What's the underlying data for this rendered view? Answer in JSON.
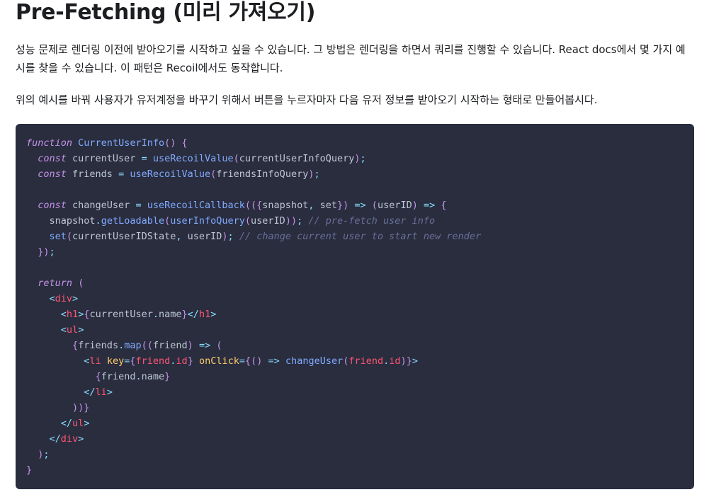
{
  "heading": "Pre-Fetching (미리 가져오기)",
  "paragraphs": [
    "성능 문제로 렌더링 이전에 받아오기를 시작하고 싶을 수 있습니다. 그 방법은 렌더링을 하면서 쿼리를 진행할 수 있습니다. React docs에서 몇 가지 예시를 찾을 수 있습니다. 이 패턴은 Recoil에서도 동작합니다.",
    "위의 예시를 바꿔 사용자가 유저계정을 바꾸기 위해서 버튼을 누르자마자 다음 유저 정보를 받아오기 시작하는 형태로 만들어봅시다."
  ],
  "code": {
    "language": "jsx",
    "lines": [
      [
        [
          "kw",
          "function"
        ],
        [
          "id",
          " "
        ],
        [
          "fn",
          "CurrentUserInfo"
        ],
        [
          "pu",
          "()"
        ],
        [
          "id",
          " "
        ],
        [
          "pu",
          "{"
        ]
      ],
      [
        [
          "id",
          "  "
        ],
        [
          "kw",
          "const"
        ],
        [
          "id",
          " currentUser "
        ],
        [
          "op",
          "="
        ],
        [
          "id",
          " "
        ],
        [
          "fn",
          "useRecoilValue"
        ],
        [
          "pu",
          "("
        ],
        [
          "id",
          "currentUserInfoQuery"
        ],
        [
          "pu",
          ")"
        ],
        [
          "op",
          ";"
        ]
      ],
      [
        [
          "id",
          "  "
        ],
        [
          "kw",
          "const"
        ],
        [
          "id",
          " friends "
        ],
        [
          "op",
          "="
        ],
        [
          "id",
          " "
        ],
        [
          "fn",
          "useRecoilValue"
        ],
        [
          "pu",
          "("
        ],
        [
          "id",
          "friendsInfoQuery"
        ],
        [
          "pu",
          ")"
        ],
        [
          "op",
          ";"
        ]
      ],
      [],
      [
        [
          "id",
          "  "
        ],
        [
          "kw",
          "const"
        ],
        [
          "id",
          " changeUser "
        ],
        [
          "op",
          "="
        ],
        [
          "id",
          " "
        ],
        [
          "fn",
          "useRecoilCallback"
        ],
        [
          "pu",
          "(({"
        ],
        [
          "id",
          "snapshot"
        ],
        [
          "op",
          ","
        ],
        [
          "id",
          " set"
        ],
        [
          "pu",
          "})"
        ],
        [
          "id",
          " "
        ],
        [
          "op",
          "=>"
        ],
        [
          "id",
          " "
        ],
        [
          "pu",
          "("
        ],
        [
          "id",
          "userID"
        ],
        [
          "pu",
          ")"
        ],
        [
          "id",
          " "
        ],
        [
          "op",
          "=>"
        ],
        [
          "id",
          " "
        ],
        [
          "pu",
          "{"
        ]
      ],
      [
        [
          "id",
          "    snapshot"
        ],
        [
          "op",
          "."
        ],
        [
          "fn",
          "getLoadable"
        ],
        [
          "pu",
          "("
        ],
        [
          "fn",
          "userInfoQuery"
        ],
        [
          "pu",
          "("
        ],
        [
          "id",
          "userID"
        ],
        [
          "pu",
          "))"
        ],
        [
          "op",
          ";"
        ],
        [
          "id",
          " "
        ],
        [
          "cm",
          "// pre-fetch user info"
        ]
      ],
      [
        [
          "id",
          "    "
        ],
        [
          "fn",
          "set"
        ],
        [
          "pu",
          "("
        ],
        [
          "id",
          "currentUserIDState"
        ],
        [
          "op",
          ","
        ],
        [
          "id",
          " userID"
        ],
        [
          "pu",
          ")"
        ],
        [
          "op",
          ";"
        ],
        [
          "id",
          " "
        ],
        [
          "cm",
          "// change current user to start new render"
        ]
      ],
      [
        [
          "id",
          "  "
        ],
        [
          "pu",
          "})"
        ],
        [
          "op",
          ";"
        ]
      ],
      [],
      [
        [
          "id",
          "  "
        ],
        [
          "kw",
          "return"
        ],
        [
          "id",
          " "
        ],
        [
          "pu",
          "("
        ]
      ],
      [
        [
          "id",
          "    "
        ],
        [
          "op",
          "<"
        ],
        [
          "tg",
          "div"
        ],
        [
          "op",
          ">"
        ]
      ],
      [
        [
          "id",
          "      "
        ],
        [
          "op",
          "<"
        ],
        [
          "tg",
          "h1"
        ],
        [
          "op",
          ">"
        ],
        [
          "pu",
          "{"
        ],
        [
          "id",
          "currentUser"
        ],
        [
          "op",
          "."
        ],
        [
          "id",
          "name"
        ],
        [
          "pu",
          "}"
        ],
        [
          "op",
          "</"
        ],
        [
          "tg",
          "h1"
        ],
        [
          "op",
          ">"
        ]
      ],
      [
        [
          "id",
          "      "
        ],
        [
          "op",
          "<"
        ],
        [
          "tg",
          "ul"
        ],
        [
          "op",
          ">"
        ]
      ],
      [
        [
          "id",
          "        "
        ],
        [
          "pu",
          "{"
        ],
        [
          "id",
          "friends"
        ],
        [
          "op",
          "."
        ],
        [
          "fn",
          "map"
        ],
        [
          "pu",
          "(("
        ],
        [
          "id",
          "friend"
        ],
        [
          "pu",
          ")"
        ],
        [
          "id",
          " "
        ],
        [
          "op",
          "=>"
        ],
        [
          "id",
          " "
        ],
        [
          "pu",
          "("
        ]
      ],
      [
        [
          "id",
          "          "
        ],
        [
          "op",
          "<"
        ],
        [
          "tg",
          "li"
        ],
        [
          "id",
          " "
        ],
        [
          "at",
          "key"
        ],
        [
          "op",
          "="
        ],
        [
          "pu",
          "{"
        ],
        [
          "tg",
          "friend"
        ],
        [
          "op",
          "."
        ],
        [
          "tg",
          "id"
        ],
        [
          "pu",
          "}"
        ],
        [
          "id",
          " "
        ],
        [
          "at",
          "onClick"
        ],
        [
          "op",
          "="
        ],
        [
          "pu",
          "{()"
        ],
        [
          "id",
          " "
        ],
        [
          "op",
          "=>"
        ],
        [
          "id",
          " "
        ],
        [
          "fn",
          "changeUser"
        ],
        [
          "pu",
          "("
        ],
        [
          "tg",
          "friend"
        ],
        [
          "op",
          "."
        ],
        [
          "tg",
          "id"
        ],
        [
          "pu",
          ")}"
        ],
        [
          "op",
          ">"
        ]
      ],
      [
        [
          "id",
          "            "
        ],
        [
          "pu",
          "{"
        ],
        [
          "id",
          "friend"
        ],
        [
          "op",
          "."
        ],
        [
          "id",
          "name"
        ],
        [
          "pu",
          "}"
        ]
      ],
      [
        [
          "id",
          "          "
        ],
        [
          "op",
          "</"
        ],
        [
          "tg",
          "li"
        ],
        [
          "op",
          ">"
        ]
      ],
      [
        [
          "id",
          "        "
        ],
        [
          "pu",
          "))}"
        ]
      ],
      [
        [
          "id",
          "      "
        ],
        [
          "op",
          "</"
        ],
        [
          "tg",
          "ul"
        ],
        [
          "op",
          ">"
        ]
      ],
      [
        [
          "id",
          "    "
        ],
        [
          "op",
          "</"
        ],
        [
          "tg",
          "div"
        ],
        [
          "op",
          ">"
        ]
      ],
      [
        [
          "id",
          "  "
        ],
        [
          "pu",
          ")"
        ],
        [
          "op",
          ";"
        ]
      ],
      [
        [
          "pu",
          "}"
        ]
      ]
    ]
  },
  "colors": {
    "code_background": "#292d3e",
    "keyword": "#c792ea",
    "function": "#82aaff",
    "identifier": "#bfc7d5",
    "operator": "#89ddff",
    "comment": "#697098",
    "tag": "#ff5572",
    "attribute": "#ffcb6b"
  }
}
